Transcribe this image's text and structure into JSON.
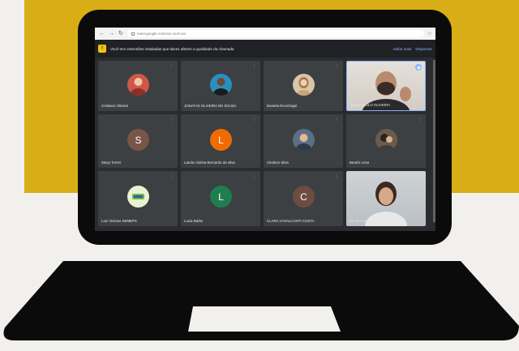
{
  "browser": {
    "url": "meet.google.com/xxx-xxxf-xxx",
    "back_icon": "arrow-left-icon",
    "forward_icon": "arrow-right-icon",
    "reload_icon": "reload-icon",
    "share_icon": "share-icon"
  },
  "banner": {
    "message": "Você tem extensões instaladas que talvez afetem a qualidade da chamada",
    "learn_more": "Saiba mais",
    "dismiss": "Dispensar"
  },
  "participants": [
    {
      "name": "Cristiano Oliveira",
      "type": "photo",
      "avatar_color": "#d0564a"
    },
    {
      "name": "JONATAS OLIVEIRA DE SOUZA",
      "type": "photo",
      "avatar_color": "#2a8fbf"
    },
    {
      "name": "Daniela Recicloigel",
      "type": "photo",
      "avatar_color": "#c2a37a"
    },
    {
      "name": "JOAO PAULO OLIVEIRA",
      "type": "video",
      "avatar_color": "#8d7b6e"
    },
    {
      "name": "Stacy Torres",
      "type": "initial",
      "initial": "S",
      "avatar_color": "#795548"
    },
    {
      "name": "Landa cristina Bernardo da silva",
      "type": "initial",
      "initial": "L",
      "avatar_color": "#ef6c00"
    },
    {
      "name": "Cledson Silva",
      "type": "photo",
      "avatar_color": "#5b6f86"
    },
    {
      "name": "Beatriz Lima",
      "type": "photo",
      "avatar_color": "#6b5b4d"
    },
    {
      "name": "Luiz Vinicius SEMEPS",
      "type": "photo",
      "avatar_color": "#e9f2d0"
    },
    {
      "name": "Lucia Barba",
      "type": "initial",
      "initial": "L",
      "avatar_color": "#1e7e4f"
    },
    {
      "name": "CLARA CAVALCANTI COSTA",
      "type": "initial",
      "initial": "C",
      "avatar_color": "#6d4c41"
    },
    {
      "name": "CLARA CAVALCANTI COSTA",
      "type": "video",
      "avatar_color": "#b9bfc3"
    }
  ],
  "colors": {
    "background_yellow": "#d8ad16",
    "laptop_black": "#0b0b0b",
    "meet_dark": "#2b2c2f",
    "tile": "#3c4043",
    "accent_blue": "#8ab4f8"
  }
}
